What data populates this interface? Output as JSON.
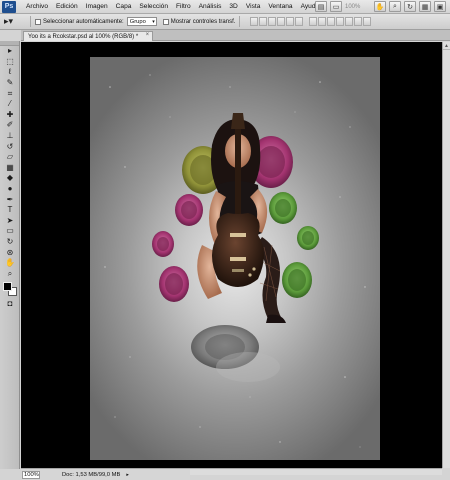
{
  "app": {
    "logo": "Ps"
  },
  "menu": [
    "Archivo",
    "Edición",
    "Imagen",
    "Capa",
    "Selección",
    "Filtro",
    "Análisis",
    "3D",
    "Vista",
    "Ventana",
    "Ayuda"
  ],
  "menubar_tools": {
    "zoom_value": "100%"
  },
  "options": {
    "auto_select_label": "Seleccionar automáticamente:",
    "auto_select_value": "Grupo",
    "show_transform_label": "Mostrar controles transf."
  },
  "document": {
    "tab_title": "Yoo its a Rcokstar.psd al 100% (RGB/8) *",
    "close_glyph": "×"
  },
  "status": {
    "zoom": "100%",
    "doc_info": "Doc: 1,53 MB/99,0 MB",
    "arrow": "▸"
  },
  "tools": [
    {
      "name": "move-tool-icon",
      "glyph": "▸"
    },
    {
      "name": "marquee-tool-icon",
      "glyph": "⬚"
    },
    {
      "name": "lasso-tool-icon",
      "glyph": "ℓ"
    },
    {
      "name": "quick-select-tool-icon",
      "glyph": "✎"
    },
    {
      "name": "crop-tool-icon",
      "glyph": "⌗"
    },
    {
      "name": "eyedropper-tool-icon",
      "glyph": "⁄"
    },
    {
      "name": "healing-brush-tool-icon",
      "glyph": "✚"
    },
    {
      "name": "brush-tool-icon",
      "glyph": "✐"
    },
    {
      "name": "clone-stamp-tool-icon",
      "glyph": "⊥"
    },
    {
      "name": "history-brush-tool-icon",
      "glyph": "↺"
    },
    {
      "name": "eraser-tool-icon",
      "glyph": "▱"
    },
    {
      "name": "gradient-tool-icon",
      "glyph": "▦"
    },
    {
      "name": "blur-tool-icon",
      "glyph": "◆"
    },
    {
      "name": "dodge-tool-icon",
      "glyph": "●"
    },
    {
      "name": "pen-tool-icon",
      "glyph": "✒"
    },
    {
      "name": "type-tool-icon",
      "glyph": "T"
    },
    {
      "name": "path-select-tool-icon",
      "glyph": "➤"
    },
    {
      "name": "shape-tool-icon",
      "glyph": "▭"
    },
    {
      "name": "3d-rotate-tool-icon",
      "glyph": "↻"
    },
    {
      "name": "3d-orbit-tool-icon",
      "glyph": "⊛"
    },
    {
      "name": "hand-tool-icon",
      "glyph": "✋"
    },
    {
      "name": "zoom-tool-icon",
      "glyph": "⌕"
    }
  ],
  "colors": {
    "magenta": "#a2336f",
    "olive": "#8f9138",
    "green": "#5b9a3a",
    "gray_disc": "#7a7a7a"
  }
}
